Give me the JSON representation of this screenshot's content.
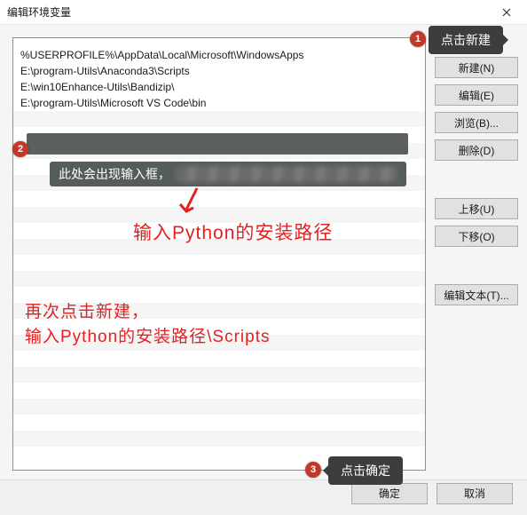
{
  "window": {
    "title": "编辑环境变量"
  },
  "list": {
    "items": [
      "%USERPROFILE%\\AppData\\Local\\Microsoft\\WindowsApps",
      "E:\\program-Utils\\Anaconda3\\Scripts",
      "E:\\win10Enhance-Utils\\Bandizip\\",
      "E:\\program-Utils\\Microsoft VS Code\\bin"
    ]
  },
  "buttons": {
    "new": "新建(N)",
    "edit": "编辑(E)",
    "browse": "浏览(B)...",
    "delete": "删除(D)",
    "up": "上移(U)",
    "down": "下移(O)",
    "edit_text": "编辑文本(T)...",
    "ok": "确定",
    "cancel": "取消"
  },
  "annotations": {
    "n1": "1",
    "n2": "2",
    "n3": "3",
    "bubble_new": "点击新建",
    "bubble_input": "此处会出现输入框，",
    "bubble_ok": "点击确定",
    "red_line1": "输入Python的安装路径",
    "red_line2a": "再次点击新建，",
    "red_line2b": "输入Python的安装路径\\Scripts"
  }
}
